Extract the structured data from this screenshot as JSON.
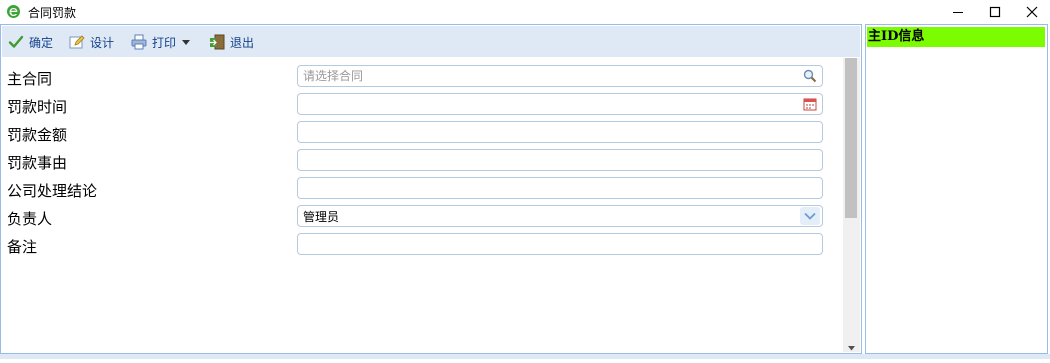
{
  "window": {
    "title": "合同罚款",
    "icon": "ie-browser-icon"
  },
  "toolbar": {
    "confirm_label": "确定",
    "design_label": "设计",
    "print_label": "打印",
    "exit_label": "退出"
  },
  "form": {
    "fields": [
      {
        "label": "主合同",
        "value": "",
        "placeholder": "请选择合同",
        "trigger": "search-icon"
      },
      {
        "label": "罚款时间",
        "value": "",
        "placeholder": "",
        "trigger": "calendar-icon"
      },
      {
        "label": "罚款金额",
        "value": "",
        "placeholder": ""
      },
      {
        "label": "罚款事由",
        "value": "",
        "placeholder": ""
      },
      {
        "label": "公司处理结论",
        "value": "",
        "placeholder": ""
      },
      {
        "label": "负责人",
        "value": "管理员",
        "placeholder": "",
        "trigger": "chevron-down-icon"
      },
      {
        "label": "备注",
        "value": "",
        "placeholder": ""
      }
    ]
  },
  "side_panel": {
    "header": "主ID信息",
    "header_color": "#7cfc00"
  },
  "colors": {
    "toolbar_bg": "#dfe9f6",
    "border": "#99bbe8",
    "link_text": "#15428b"
  }
}
